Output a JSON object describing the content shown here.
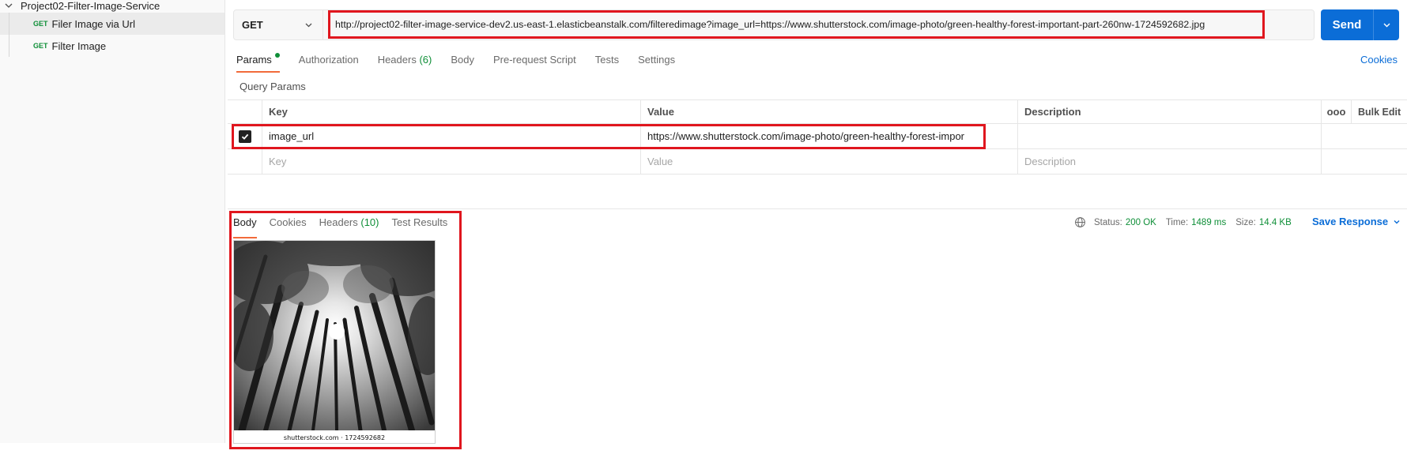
{
  "sidebar": {
    "collection_name": "Project02-Filter-Image-Service",
    "items": [
      {
        "method": "GET",
        "label": "Filer Image via Url"
      },
      {
        "method": "GET",
        "label": "Filter Image"
      }
    ]
  },
  "request": {
    "method": "GET",
    "url": "http://project02-filter-image-service-dev2.us-east-1.elasticbeanstalk.com/filteredimage?image_url=https://www.shutterstock.com/image-photo/green-healthy-forest-important-part-260nw-1724592682.jpg",
    "send_label": "Send"
  },
  "request_tabs": {
    "params": "Params",
    "authorization": "Authorization",
    "headers": "Headers",
    "headers_count": "(6)",
    "body": "Body",
    "pre_request": "Pre-request Script",
    "tests": "Tests",
    "settings": "Settings",
    "cookies": "Cookies"
  },
  "query_params": {
    "title": "Query Params",
    "headers": {
      "key": "Key",
      "value": "Value",
      "description": "Description",
      "more": "ooo",
      "bulk_edit": "Bulk Edit"
    },
    "rows": [
      {
        "checked": true,
        "key": "image_url",
        "value": "https://www.shutterstock.com/image-photo/green-healthy-forest-impor",
        "description": ""
      }
    ],
    "placeholders": {
      "key": "Key",
      "value": "Value",
      "description": "Description"
    }
  },
  "response": {
    "tabs": {
      "body": "Body",
      "cookies": "Cookies",
      "headers": "Headers",
      "headers_count": "(10)",
      "test_results": "Test Results"
    },
    "status_label": "Status:",
    "status_value": "200 OK",
    "time_label": "Time:",
    "time_value": "1489 ms",
    "size_label": "Size:",
    "size_value": "14.4 KB",
    "save_label": "Save Response",
    "image_caption": "shutterstock.com · 1724592682"
  },
  "colors": {
    "accent_blue": "#0b6dd7",
    "status_green": "#0f8f38",
    "tab_underline": "#f26b3a",
    "highlight_red": "#e0161e"
  }
}
